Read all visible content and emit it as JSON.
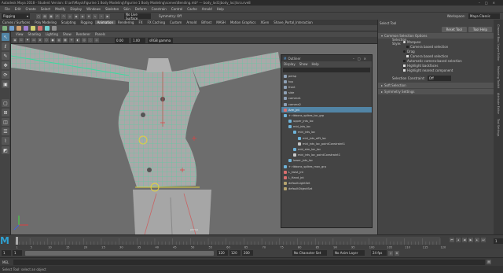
{
  "window": {
    "title": "Autodesk Maya 2018 - Student Version: E:\\art\\Maya\\Figurine 1 Body Modeling\\Figurine 1 Body Modeling\\scenes\\Bending.mb* --- body_lod1|body_loc|tsrcurve8"
  },
  "menubar": [
    "File",
    "Edit",
    "Create",
    "Select",
    "Modify",
    "Display",
    "Windows",
    "Skeleton",
    "Skin",
    "Deform",
    "Constrain",
    "Control",
    "Cache",
    "Arnold",
    "Help"
  ],
  "menu_mode": "Rigging",
  "statusline": {
    "no_live_surface": "No Live Surface",
    "symmetry": "Symmetry: Off",
    "workspace_label": "Workspace:",
    "workspace_value": "Maya Classic"
  },
  "shelf_tabs": [
    "Curves / Surfaces",
    "Poly Modeling",
    "Sculpting",
    "Rigging",
    "Animation",
    "Rendering",
    "FX",
    "FX Caching",
    "Custom",
    "Arnold",
    "Bifrost",
    "MASH",
    "Motion Graphics",
    "XGen",
    "Shave_Portal_Interaction"
  ],
  "active_shelf_tab": "Animation",
  "viewport": {
    "menu": [
      "View",
      "Shading",
      "Lighting",
      "Show",
      "Renderer",
      "Panels"
    ],
    "camera_label": "persp",
    "gamma": "sRGB gamma",
    "field1": "0.00",
    "field2": "1.00"
  },
  "outliner": {
    "title": "Outliner",
    "menu": [
      "Display",
      "Show",
      "Help"
    ],
    "items": [
      {
        "label": "persp",
        "indent": 0,
        "color": "#8da0b5",
        "selected": false
      },
      {
        "label": "top",
        "indent": 0,
        "color": "#8da0b5",
        "selected": false
      },
      {
        "label": "front",
        "indent": 0,
        "color": "#8da0b5",
        "selected": false
      },
      {
        "label": "side",
        "indent": 0,
        "color": "#8da0b5",
        "selected": false
      },
      {
        "label": "camera1",
        "indent": 0,
        "color": "#8da0b5",
        "selected": false
      },
      {
        "label": "camera2",
        "indent": 0,
        "color": "#8da0b5",
        "selected": false
      },
      {
        "label": "Arm_jnt",
        "indent": 0,
        "color": "#d96f6f",
        "selected": true
      },
      {
        "label": "+ ribbons_spikes_loc_grp",
        "indent": 0,
        "color": "#6fb3d9",
        "selected": false
      },
      {
        "label": "upper_jnts_loc",
        "indent": 1,
        "color": "#6fb3d9",
        "selected": false
      },
      {
        "label": "mid_jnts_loc",
        "indent": 1,
        "color": "#6fb3d9",
        "selected": false
      },
      {
        "label": "mid_jnts_loc",
        "indent": 2,
        "color": "#6fb3d9",
        "selected": false
      },
      {
        "label": "mid_jnts_offt_loc",
        "indent": 3,
        "color": "#6fb3d9",
        "selected": false
      },
      {
        "label": "mid_jnts_loc_pointConstraint1",
        "indent": 3,
        "color": "#c8c8c8",
        "selected": false
      },
      {
        "label": "mid_aim_loc_loc",
        "indent": 2,
        "color": "#6fb3d9",
        "selected": false
      },
      {
        "label": "mid_jnts_loc_pointConstraint1",
        "indent": 2,
        "color": "#c8c8c8",
        "selected": false
      },
      {
        "label": "lower_jnts_loc",
        "indent": 1,
        "color": "#6fb3d9",
        "selected": false
      },
      {
        "label": "+ ribbons_spikes_mov_grp",
        "indent": 0,
        "color": "#6fb3d9",
        "selected": false
      },
      {
        "label": "L_twist_jnt",
        "indent": 0,
        "color": "#d96f6f",
        "selected": false
      },
      {
        "label": "L_Hand_jnt",
        "indent": 0,
        "color": "#d96f6f",
        "selected": false
      },
      {
        "label": "defaultLightSet",
        "indent": 0,
        "color": "#b5a36f",
        "selected": false
      },
      {
        "label": "defaultObjectSet",
        "indent": 0,
        "color": "#b5a36f",
        "selected": false
      }
    ]
  },
  "right_panel": {
    "header": "Select Tool",
    "reset_label": "Reset Tool",
    "help_label": "Tool Help",
    "common_section": "Common Selection Options",
    "selection_style_label": "Selection Style:",
    "options": [
      {
        "type": "radio",
        "label": "Marquee",
        "on": true
      },
      {
        "type": "check",
        "label": "Camera based selection",
        "on": false
      },
      {
        "type": "radio",
        "label": "Drag",
        "on": false
      },
      {
        "type": "check",
        "label": "Camera based selection",
        "on": true
      },
      {
        "type": "check",
        "label": "Automatic camera-based selection",
        "on": false
      },
      {
        "type": "check",
        "label": "Highlight backfaces",
        "on": true
      },
      {
        "type": "check",
        "label": "Highlight nearest component",
        "on": true
      }
    ],
    "constraint_label": "Selection Constraint:",
    "constraint_value": "Off",
    "soft_section": "Soft Selection",
    "symmetry_section": "Symmetry Settings"
  },
  "side_tabs": [
    "Channel Box / Layer Editor",
    "Modeling Toolkit",
    "Attribute Editor",
    "Tool Settings"
  ],
  "timeline": {
    "ticks": [
      "1",
      "5",
      "10",
      "15",
      "20",
      "25",
      "30",
      "35",
      "40",
      "45",
      "50",
      "55",
      "60",
      "65",
      "70",
      "75",
      "80",
      "85",
      "90",
      "95",
      "100",
      "105",
      "110",
      "115",
      "120"
    ],
    "current_frame": "1"
  },
  "range": {
    "start": "1",
    "start2": "1",
    "end": "120",
    "end2": "120",
    "end3": "200",
    "fps_label": "No Character Set",
    "anim_layer": "No Anim Layer",
    "fps": "24 fps"
  },
  "command": {
    "label": "MEL"
  },
  "help_line": "Select Tool: select an object",
  "logo": "M"
}
